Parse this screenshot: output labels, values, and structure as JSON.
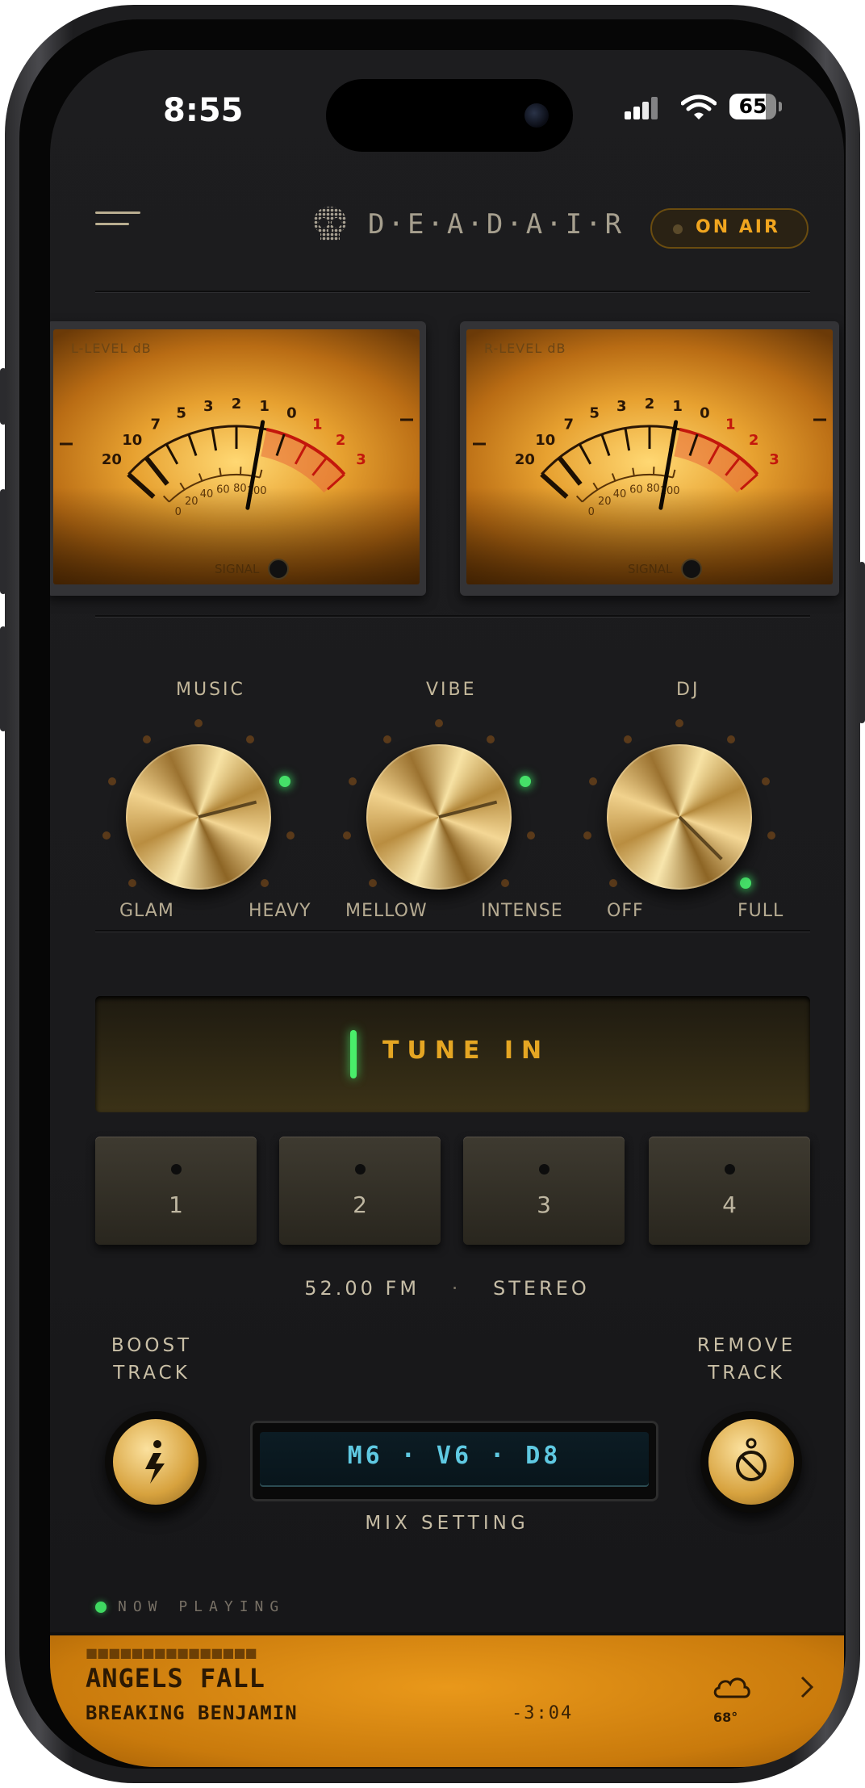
{
  "status": {
    "time": "8:55",
    "battery": "65"
  },
  "header": {
    "logo_text": "D·E·A·D·A·I·R",
    "on_air_label": "ON AIR"
  },
  "meters": [
    {
      "label": "L-LEVEL dB",
      "sig": "SIGNAL"
    },
    {
      "label": "R-LEVEL dB",
      "sig": "SIGNAL"
    }
  ],
  "meter_scale": {
    "upper": [
      "20",
      "10",
      "7",
      "5",
      "3",
      "2",
      "1",
      "0",
      "1",
      "2",
      "3"
    ],
    "lower": [
      "0",
      "20",
      "40",
      "60",
      "80",
      "100"
    ]
  },
  "knobs": [
    {
      "title": "MUSIC",
      "min_label": "GLAM",
      "max_label": "HEAVY",
      "level": 0.78
    },
    {
      "title": "VIBE",
      "min_label": "MELLOW",
      "max_label": "INTENSE",
      "level": 0.78
    },
    {
      "title": "DJ",
      "min_label": "OFF",
      "max_label": "FULL",
      "level": 1.0
    }
  ],
  "tune_button": "TUNE IN",
  "presets": [
    "1",
    "2",
    "3",
    "4"
  ],
  "frequency": {
    "value": "52.00 FM",
    "separator": "·",
    "mode": "STEREO"
  },
  "boost": {
    "line1": "BOOST",
    "line2": "TRACK"
  },
  "remove": {
    "line1": "REMOVE",
    "line2": "TRACK"
  },
  "mix": {
    "display": "M6 · V6 · D8",
    "label": "MIX SETTING"
  },
  "now_playing": {
    "label": "NOW PLAYING",
    "title": "ANGELS FALL",
    "artist": "BREAKING BENJAMIN",
    "remaining": "-3:04",
    "temperature": "68°",
    "weather_icon": "cloud-icon"
  },
  "colors": {
    "accent": "#f0a51f",
    "led_green": "#45e068",
    "lcd_text": "#5fc9e2"
  }
}
